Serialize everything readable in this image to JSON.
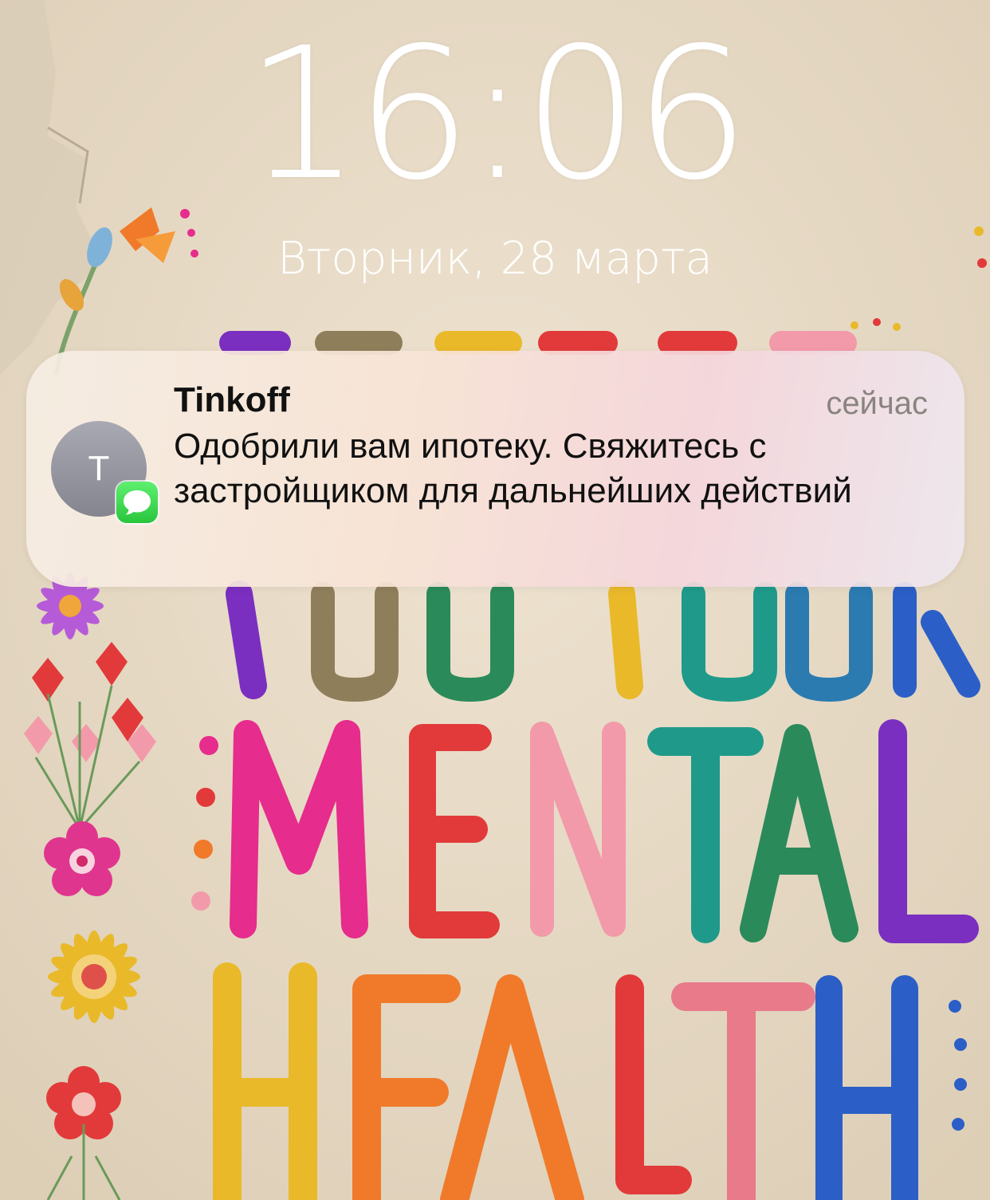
{
  "lockscreen": {
    "time": "16:06",
    "date": "Вторник, 28 марта"
  },
  "notification": {
    "sender": "Tinkoff",
    "time_ago": "сейчас",
    "avatar_initial": "T",
    "app_badge_icon": "messages-icon",
    "message": "Одобрили вам ипотеку. Свяжитесь с застройщиком для дальнейших действий"
  },
  "wallpaper": {
    "lines": [
      "YOU YOUR",
      "MENTAL",
      "HEALTH"
    ],
    "colors": {
      "background": "#e6d9c4",
      "magenta": "#e62c8c",
      "orange": "#f07a2a",
      "teal": "#1f9a8a",
      "blue": "#2b5fc7",
      "purple": "#7a2fc0",
      "yellow": "#e9b92a",
      "red": "#e23a3a",
      "pink": "#f29aaa"
    }
  }
}
